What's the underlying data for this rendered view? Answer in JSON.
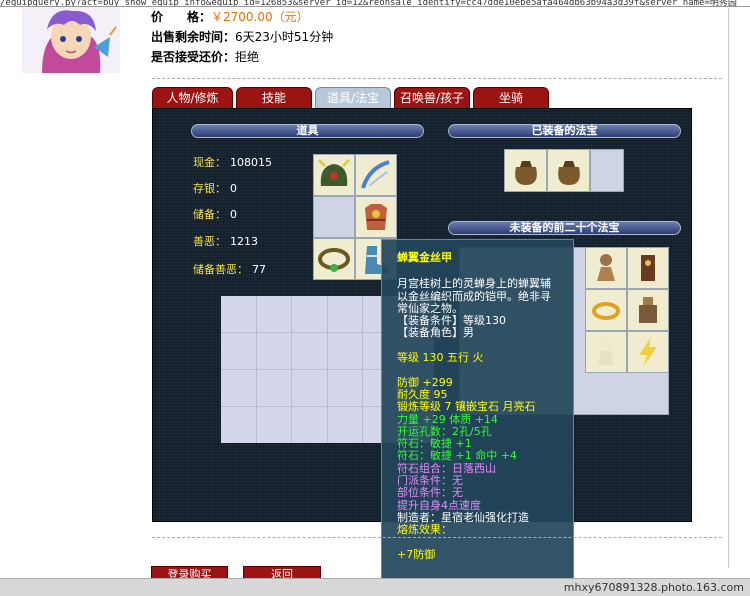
{
  "url": "/equipquery.py?act=buy_show_equip_info&equip_id=126853&server_id=12&reonsale_identify=cc47dde10ebe5afa464db63b94a3d39f&server_name=明秀园",
  "info": {
    "price_label": "价　　格：",
    "price_value": "￥2700.00（元）",
    "time_label": "出售剩余时间：",
    "time_value": "6天23小时51分钟",
    "accept_label": "是否接受还价：",
    "accept_value": "拒绝"
  },
  "tabs": [
    {
      "label": "人物/修炼"
    },
    {
      "label": "技能"
    },
    {
      "label": "道具/法宝",
      "active": true
    },
    {
      "label": "召唤兽/孩子"
    },
    {
      "label": "坐骑"
    }
  ],
  "headers": {
    "items": "道具",
    "equipped": "已装备的法宝",
    "unequipped": "未装备的前二十个法宝"
  },
  "stats": [
    {
      "label": "现金：",
      "value": "108015"
    },
    {
      "label": "存银：",
      "value": "0"
    },
    {
      "label": "储备：",
      "value": "0"
    },
    {
      "label": "善恶：",
      "value": "1213"
    },
    {
      "label": "储备善恶：",
      "value": "77"
    }
  ],
  "tooltip": {
    "title": "蝉翼金丝甲",
    "lines": [
      {
        "text": "月宫桂树上的灵蝉身上的蝉翼辅",
        "color": "white"
      },
      {
        "text": "以金丝编织而成的铠甲。绝非寻",
        "color": "white"
      },
      {
        "text": "常仙家之物。",
        "color": "white"
      },
      {
        "text": "【装备条件】等级130",
        "color": "white"
      },
      {
        "text": "【装备角色】男",
        "color": "white"
      },
      {
        "text": "",
        "color": "white"
      },
      {
        "text": "等级 130 五行 火",
        "color": "yellow"
      },
      {
        "text": "",
        "color": "white"
      },
      {
        "text": "防御 +299",
        "color": "yellow"
      },
      {
        "text": "耐久度 95",
        "color": "yellow"
      },
      {
        "text": "锻炼等级 7 镶嵌宝石 月亮石",
        "color": "yellow"
      },
      {
        "text": "力量 +29 体质 +14",
        "color": "green"
      },
      {
        "text": "开运孔数：2孔/5孔",
        "color": "green"
      },
      {
        "text": "符石：敏捷 +1",
        "color": "green"
      },
      {
        "text": "符石：敏捷 +1 命中 +4",
        "color": "green"
      },
      {
        "text": "符石组合：日落西山",
        "color": "purple"
      },
      {
        "text": "门派条件：无",
        "color": "purple"
      },
      {
        "text": "部位条件：无",
        "color": "purple"
      },
      {
        "text": "提升自身4点速度",
        "color": "purple"
      },
      {
        "text": "制造者：星宿老仙强化打造",
        "color": "white"
      },
      {
        "text": "熔炼效果：",
        "color": "yellow"
      },
      {
        "text": "",
        "color": "white"
      },
      {
        "text": "+7防御",
        "color": "yellow"
      }
    ]
  },
  "buttons": {
    "buy": "登录购买",
    "back": "返回"
  },
  "footer": "mhxy670891328.photo.163.com",
  "colors": {
    "tab_red": "#9b1414",
    "tab_active": "#b7c9d8",
    "panel_bg": "#13202c",
    "stat_label": "#f3e04a",
    "price": "#e8700a"
  }
}
